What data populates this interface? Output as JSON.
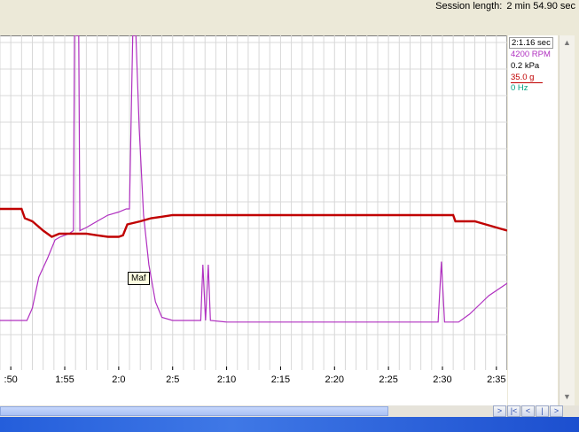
{
  "header": {
    "session_label": "Session length:",
    "session_value": "2 min 54.90 sec"
  },
  "legend": {
    "time": "2:1.16 sec",
    "rpm": "4200 RPM",
    "kpa": "0.2 kPa",
    "maf": "35.0 g",
    "hz": "0 Hz"
  },
  "colors": {
    "rpm": "#b030c0",
    "kpa": "#000000",
    "maf": "#c00000",
    "hz": "#00a080",
    "grid": "#d8d8d8"
  },
  "tooltip": {
    "text": "Maf"
  },
  "chart_data": {
    "type": "line",
    "x_unit": "seconds (m:ss)",
    "x_range": [
      109,
      156
    ],
    "x_ticks": [
      {
        "t": 110,
        "label": ":50"
      },
      {
        "t": 115,
        "label": "1:55"
      },
      {
        "t": 120,
        "label": "2:0"
      },
      {
        "t": 125,
        "label": "2:5"
      },
      {
        "t": 130,
        "label": "2:10"
      },
      {
        "t": 135,
        "label": "2:15"
      },
      {
        "t": 140,
        "label": "2:20"
      },
      {
        "t": 145,
        "label": "2:25"
      },
      {
        "t": 150,
        "label": "2:30"
      },
      {
        "t": 155,
        "label": "2:35"
      }
    ],
    "y_range": [
      0,
      100
    ],
    "grid": true,
    "series": [
      {
        "key": "rpm",
        "points": [
          [
            109,
            8
          ],
          [
            111.5,
            8
          ],
          [
            112,
            12
          ],
          [
            112.6,
            22
          ],
          [
            113.4,
            28
          ],
          [
            114.1,
            34
          ],
          [
            114.6,
            35
          ],
          [
            115.4,
            36
          ],
          [
            115.8,
            37
          ],
          [
            115.9,
            100
          ],
          [
            116.3,
            100
          ],
          [
            116.4,
            37
          ],
          [
            117,
            38
          ],
          [
            118,
            40
          ],
          [
            119,
            42
          ],
          [
            120,
            43
          ],
          [
            120.7,
            44
          ],
          [
            121,
            44
          ],
          [
            121.3,
            100
          ],
          [
            121.6,
            100
          ],
          [
            121.9,
            70
          ],
          [
            122.3,
            42
          ],
          [
            122.8,
            26
          ],
          [
            123.4,
            14
          ],
          [
            124,
            9
          ],
          [
            125,
            8
          ],
          [
            126,
            8
          ],
          [
            127.6,
            8
          ],
          [
            127.8,
            26
          ],
          [
            128.05,
            8
          ],
          [
            128.3,
            26
          ],
          [
            128.5,
            8
          ],
          [
            130,
            7.5
          ],
          [
            135,
            7.5
          ],
          [
            140,
            7.5
          ],
          [
            145,
            7.5
          ],
          [
            149.6,
            7.5
          ],
          [
            149.9,
            27
          ],
          [
            150.2,
            7.5
          ],
          [
            151.5,
            7.5
          ],
          [
            152.5,
            10
          ],
          [
            153.4,
            13
          ],
          [
            154.3,
            16
          ],
          [
            156,
            20
          ]
        ]
      },
      {
        "key": "maf",
        "points": [
          [
            109,
            44
          ],
          [
            110.4,
            44
          ],
          [
            111,
            44
          ],
          [
            111.3,
            41
          ],
          [
            112,
            40
          ],
          [
            113,
            37
          ],
          [
            113.8,
            35
          ],
          [
            114.5,
            36
          ],
          [
            115.5,
            36
          ],
          [
            117,
            36
          ],
          [
            118,
            35.5
          ],
          [
            119,
            35
          ],
          [
            120,
            35
          ],
          [
            120.4,
            35.5
          ],
          [
            120.8,
            39
          ],
          [
            122,
            40
          ],
          [
            123,
            41
          ],
          [
            124,
            41.5
          ],
          [
            125,
            42
          ],
          [
            130,
            42
          ],
          [
            135,
            42
          ],
          [
            140,
            42
          ],
          [
            145,
            42
          ],
          [
            149,
            42
          ],
          [
            150,
            42
          ],
          [
            151,
            42
          ],
          [
            151.2,
            40
          ],
          [
            152,
            40
          ],
          [
            153,
            40
          ],
          [
            154,
            39
          ],
          [
            155,
            38
          ],
          [
            156,
            37
          ]
        ]
      }
    ]
  }
}
